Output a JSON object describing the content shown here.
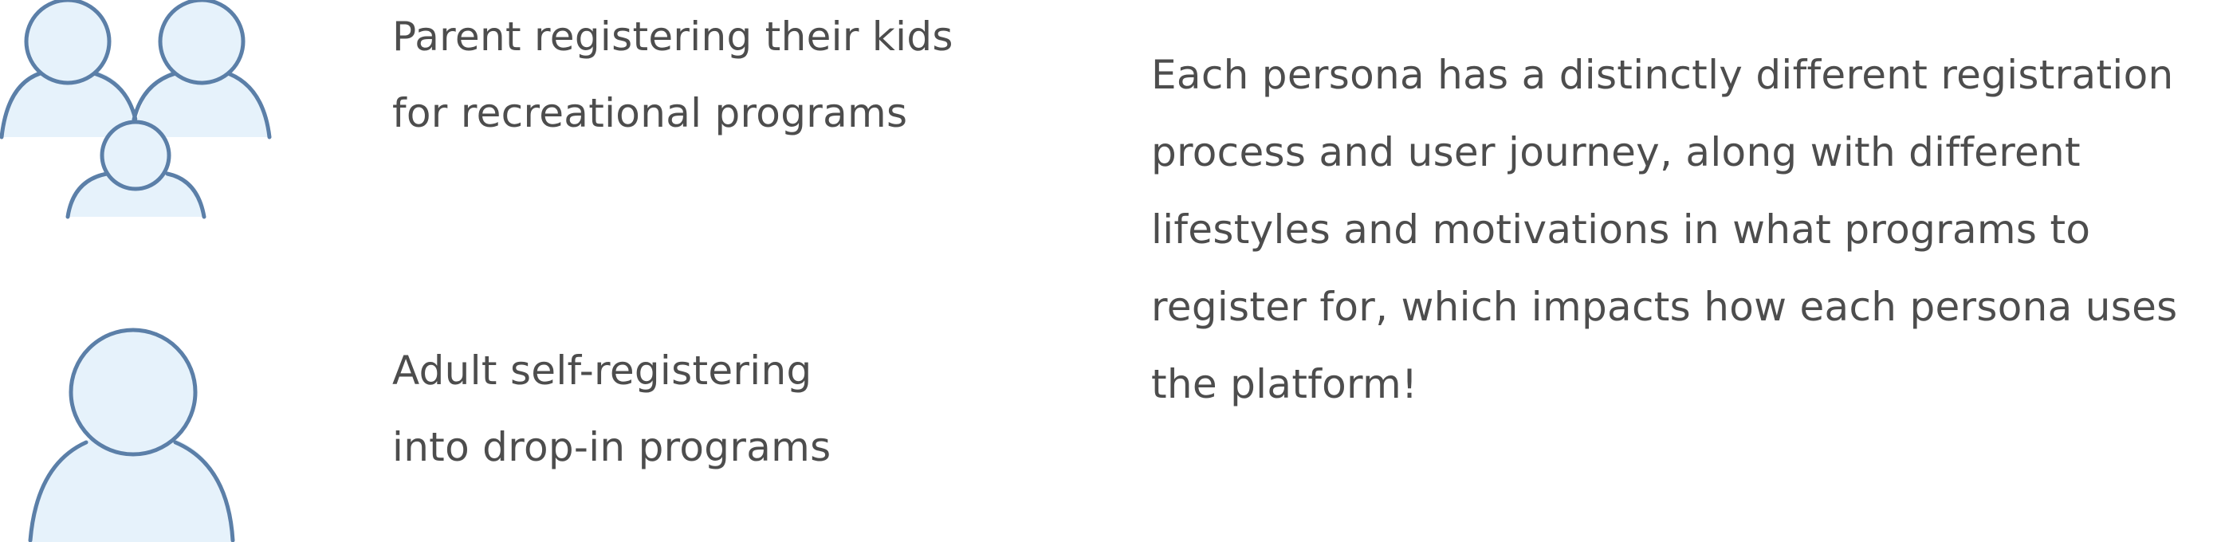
{
  "personas": [
    {
      "icon": "family-icon",
      "label_lines": [
        "Parent registering their kids",
        "for recreational programs"
      ]
    },
    {
      "icon": "adult-person-icon",
      "label_lines": [
        "Adult self-registering",
        "into drop-in programs"
      ]
    }
  ],
  "summary": {
    "lines": [
      "Each persona has a distinctly different registration",
      "process and user journey, along with different",
      "lifestyles and motivations in what programs to",
      "register for, which impacts how each persona uses",
      "the platform!"
    ]
  },
  "colors": {
    "icon_stroke": "#5b7fa8",
    "icon_fill": "#e6f2fb",
    "text": "#4d4d4d"
  }
}
